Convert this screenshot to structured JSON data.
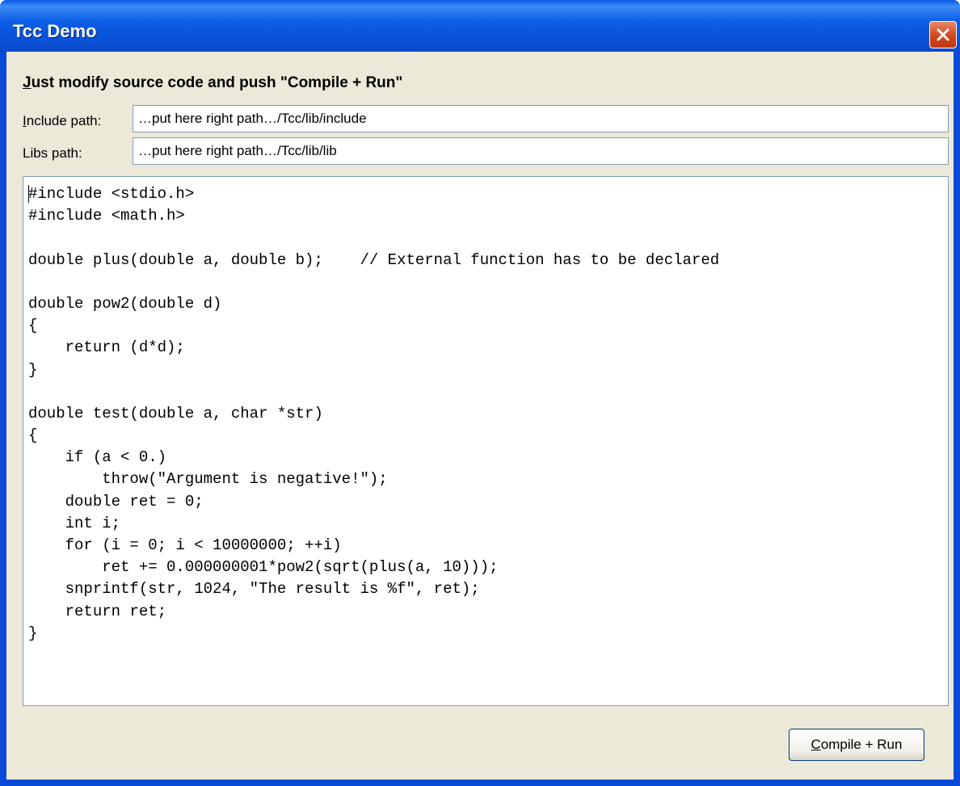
{
  "window": {
    "title": "Tcc Demo"
  },
  "heading": {
    "mnemonic": "J",
    "rest": "ust modify source code and push \"Compile + Run\""
  },
  "include_path": {
    "label_mnemonic": "I",
    "label_rest": "nclude path:",
    "value": "…put here right path…/Tcc/lib/include"
  },
  "libs_path": {
    "label": "Libs path:",
    "value": "…put here right path…/Tcc/lib/lib"
  },
  "source_code": {
    "lines": [
      "#include <stdio.h>",
      "#include <math.h>",
      "",
      "double plus(double a, double b);    // External function has to be declared",
      "",
      "double pow2(double d)",
      "{",
      "    return (d*d);",
      "}",
      "",
      "double test(double a, char *str)",
      "{",
      "    if (a < 0.)",
      "        throw(\"Argument is negative!\");",
      "    double ret = 0;",
      "    int i;",
      "    for (i = 0; i < 10000000; ++i)",
      "        ret += 0.000000001*pow2(sqrt(plus(a, 10)));",
      "    snprintf(str, 1024, \"The result is %f\", ret);",
      "    return ret;",
      "}"
    ]
  },
  "run_button": {
    "mnemonic": "C",
    "rest": "ompile + Run"
  },
  "icons": {
    "close": "close-x-icon"
  },
  "colors": {
    "titlebar": "#0a52d8",
    "client_bg": "#ece9d8",
    "close_button": "#d2441a",
    "input_border": "#7f9db9"
  }
}
